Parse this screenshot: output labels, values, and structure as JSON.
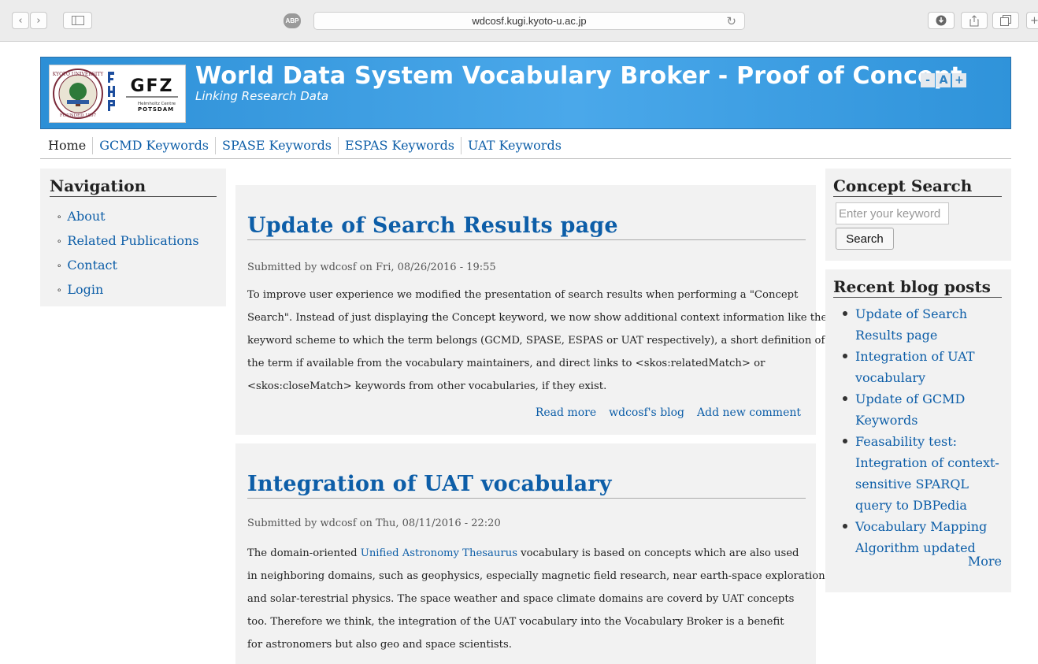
{
  "browser": {
    "url": "wdcosf.kugi.kyoto-u.ac.jp",
    "adblock_label": "ABP"
  },
  "header": {
    "site_title": "World Data System Vocabulary Broker - Proof of Concept",
    "site_slogan": "Linking Research Data",
    "font_controls": [
      "-",
      "A",
      "+"
    ],
    "logo_text": {
      "gfz": "GFZ",
      "gfz_line1": "Helmholtz Centre",
      "gfz_line2": "POTSDAM",
      "kyoto_ring": "KYOTO UNIVERSITY",
      "kyoto_founded": "FOUNDED 1897"
    }
  },
  "main_menu": [
    "Home",
    "GCMD Keywords",
    "SPASE Keywords",
    "ESPAS Keywords",
    "UAT Keywords"
  ],
  "navigation": {
    "title": "Navigation",
    "items": [
      "About",
      "Related Publications",
      "Contact",
      "Login"
    ]
  },
  "concept_search": {
    "title": "Concept Search",
    "placeholder": "Enter your keyword",
    "button": "Search"
  },
  "recent_posts": {
    "title": "Recent blog posts",
    "items": [
      "Update of Search Results page",
      "Integration of UAT vocabulary",
      "Update of GCMD Keywords",
      "Feasability test: Integration of context-sensitive SPARQL query to DBPedia",
      "Vocabulary Mapping Algorithm updated"
    ],
    "more": "More"
  },
  "posts": [
    {
      "title": "Update of Search Results page",
      "submitted": "Submitted by wdcosf on Fri, 08/26/2016 - 19:55",
      "lines": [
        "To improve user experience we modified the presentation of search results when performing a \"Concept",
        "Search\". Instead of just displaying the Concept keyword, we now show additional context information like the",
        "keyword scheme to which the term belongs (GCMD, SPASE, ESPAS or UAT respectively), a short definition of",
        "the term if available from the vocabulary maintainers, and direct links to <skos:relatedMatch> or",
        "<skos:closeMatch> keywords from other vocabularies, if they exist."
      ],
      "links": [
        "Read more",
        "wdcosf's blog",
        "Add new comment"
      ]
    },
    {
      "title": "Integration of UAT vocabulary",
      "submitted": "Submitted by wdcosf on Thu, 08/11/2016 - 22:20",
      "line1_prefix": "The domain-oriented ",
      "line1_link": "Unified Astronomy Thesaurus",
      "line1_suffix": " vocabulary is based on concepts which are also used",
      "lines": [
        "in neighboring domains, such as geophysics, especially magnetic field research, near earth-space exploration",
        "and solar-terestrial physics. The space weather and space climate domains are coverd by UAT concepts",
        "too. Therefore we think, the integration of the UAT vocabulary into the Vocabulary Broker is a benefit",
        "for astronomers but also geo and space scientists."
      ]
    }
  ]
}
